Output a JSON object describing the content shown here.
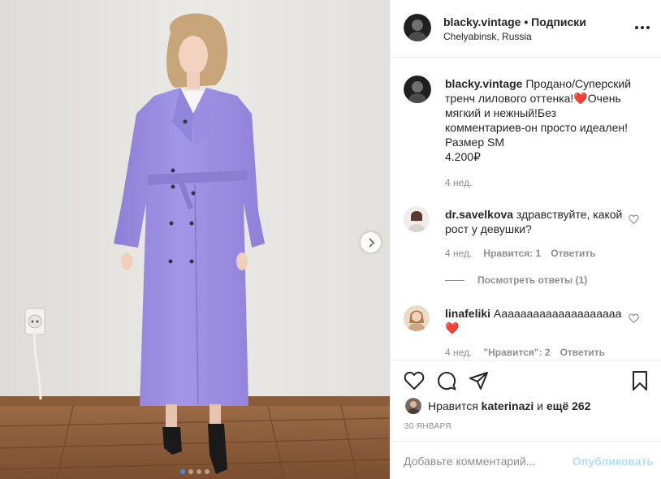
{
  "photo": {
    "carousel_dots": 4,
    "active_dot": 0,
    "next_icon": "chevron-right-icon"
  },
  "header": {
    "username": "blacky.vintage",
    "separator": "•",
    "follow_label": "Подписки",
    "location": "Chelyabinsk, Russia",
    "more_icon": "more-options-icon"
  },
  "caption": {
    "username": "blacky.vintage",
    "text_before_emoji": "Продано/Суперский тренч лилового оттенка!",
    "emoji": "❤️",
    "text_after_emoji": "Очень мягкий и нежный!Без комментариев-он просто идеален!",
    "size_line": "Размер SM",
    "price": "4.200₽",
    "time": "4 нед."
  },
  "comments": [
    {
      "username": "dr.savelkova",
      "text": "здравствуйте, какой рост у девушки?",
      "time": "4 нед.",
      "likes": "Нравится: 1",
      "reply": "Ответить",
      "view_replies": "Посмотреть ответы (1)"
    },
    {
      "username": "linafeliki",
      "text": "Аааааааааааааааааааа",
      "emoji": "❤️",
      "time": "4 нед.",
      "likes": "\"Нравится\": 2",
      "reply": "Ответить"
    }
  ],
  "actions": {
    "like_icon": "heart-icon",
    "comment_icon": "comment-icon",
    "share_icon": "paper-plane-icon",
    "save_icon": "bookmark-icon"
  },
  "likes_line": {
    "prefix": "Нравится",
    "user": "katerinazi",
    "middle": "и",
    "others": "ещё 262"
  },
  "date": "30 ЯНВАРЯ",
  "add_comment": {
    "placeholder": "Добавьте комментарий...",
    "publish_label": "Опубликовать"
  },
  "colors": {
    "coat": "#9d8fe2",
    "link_disabled": "#b2dffc",
    "muted": "#8e8e8e",
    "heart_red": "#ed1c2e"
  }
}
